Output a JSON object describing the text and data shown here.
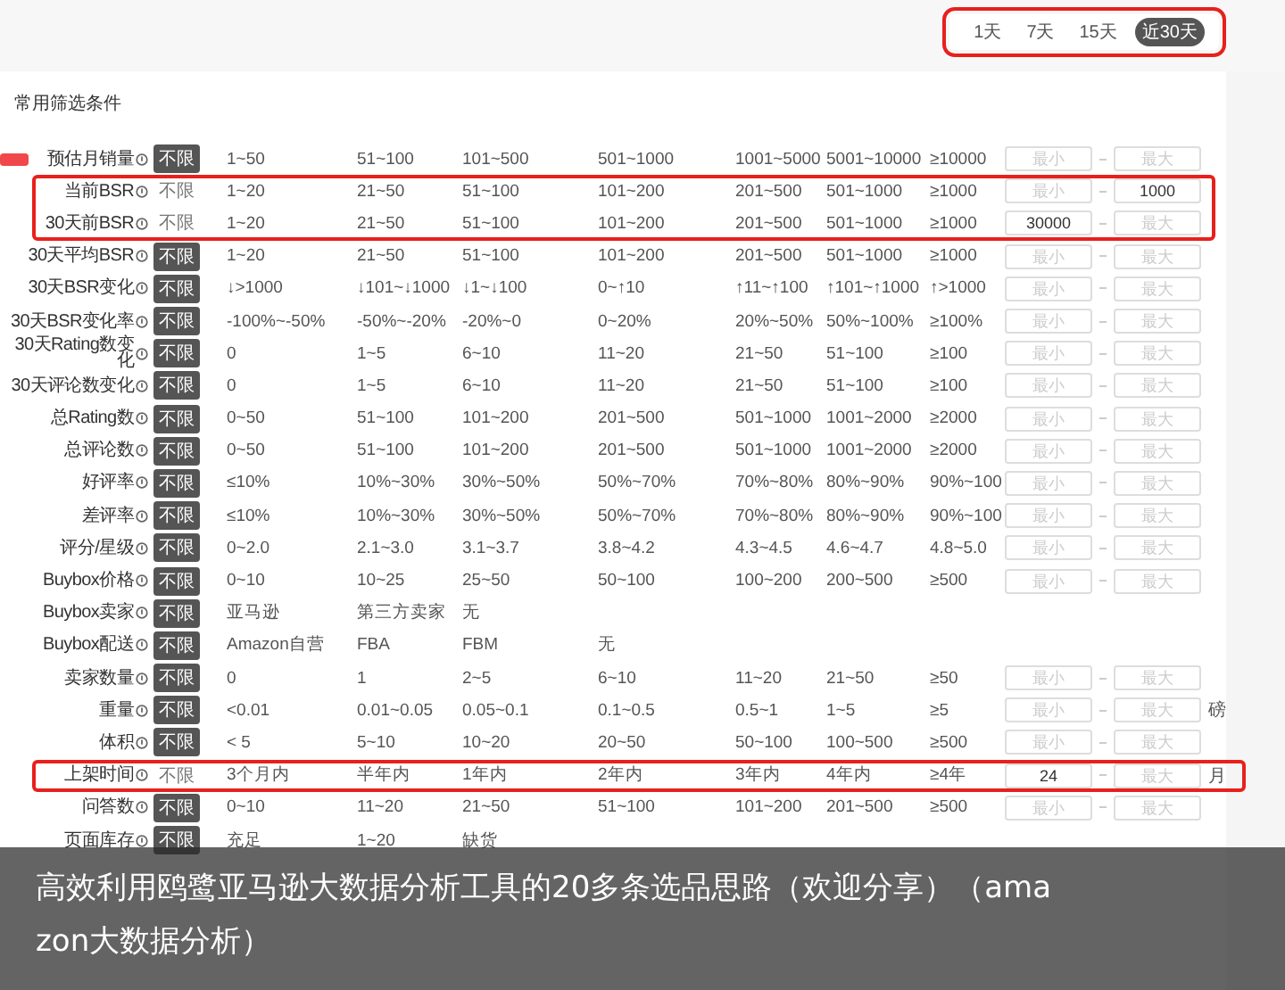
{
  "time_filter": {
    "marked": true,
    "options": [
      {
        "label": "1天",
        "selected": false
      },
      {
        "label": "7天",
        "selected": false
      },
      {
        "label": "15天",
        "selected": false
      },
      {
        "label": "近30天",
        "selected": true
      }
    ]
  },
  "section_title": "常用筛选条件",
  "rows": [
    {
      "label": "预估月销量",
      "new": true,
      "marked": false,
      "any": {
        "label": "不限",
        "selected": true
      },
      "options": [
        "1~50",
        "51~100",
        "101~500",
        "501~1000",
        "1001~5000",
        "5001~10000",
        "≥10000"
      ],
      "min": {
        "placeholder": "最小"
      },
      "max": {
        "placeholder": "最大"
      }
    },
    {
      "label": "当前BSR",
      "new": false,
      "marked": true,
      "any": {
        "label": "不限",
        "selected": false
      },
      "options": [
        "1~20",
        "21~50",
        "51~100",
        "101~200",
        "201~500",
        "501~1000",
        "≥1000"
      ],
      "min": {
        "placeholder": "最小"
      },
      "max": {
        "value": "1000"
      }
    },
    {
      "label": "30天前BSR",
      "new": false,
      "marked": true,
      "any": {
        "label": "不限",
        "selected": false
      },
      "options": [
        "1~20",
        "21~50",
        "51~100",
        "101~200",
        "201~500",
        "501~1000",
        "≥1000"
      ],
      "min": {
        "value": "30000"
      },
      "max": {
        "placeholder": "最大"
      }
    },
    {
      "label": "30天平均BSR",
      "new": false,
      "marked": false,
      "any": {
        "label": "不限",
        "selected": true
      },
      "options": [
        "1~20",
        "21~50",
        "51~100",
        "101~200",
        "201~500",
        "501~1000",
        "≥1000"
      ],
      "min": {
        "placeholder": "最小"
      },
      "max": {
        "placeholder": "最大"
      }
    },
    {
      "label": "30天BSR变化",
      "new": false,
      "marked": false,
      "any": {
        "label": "不限",
        "selected": true
      },
      "options": [
        "↓>1000",
        "↓101~↓1000",
        "↓1~↓100",
        "0~↑10",
        "↑11~↑100",
        "↑101~↑1000",
        "↑>1000"
      ],
      "min": {
        "placeholder": "最小"
      },
      "max": {
        "placeholder": "最大"
      }
    },
    {
      "label": "30天BSR变化率",
      "new": false,
      "marked": false,
      "any": {
        "label": "不限",
        "selected": true
      },
      "options": [
        "-100%~-50%",
        "-50%~-20%",
        "-20%~0",
        "0~20%",
        "20%~50%",
        "50%~100%",
        "≥100%"
      ],
      "min": {
        "placeholder": "最小"
      },
      "max": {
        "placeholder": "最大"
      }
    },
    {
      "label": "30天Rating数变化",
      "new": false,
      "marked": false,
      "any": {
        "label": "不限",
        "selected": true
      },
      "options": [
        "0",
        "1~5",
        "6~10",
        "11~20",
        "21~50",
        "51~100",
        "≥100"
      ],
      "min": {
        "placeholder": "最小"
      },
      "max": {
        "placeholder": "最大"
      }
    },
    {
      "label": "30天评论数变化",
      "new": false,
      "marked": false,
      "any": {
        "label": "不限",
        "selected": true
      },
      "options": [
        "0",
        "1~5",
        "6~10",
        "11~20",
        "21~50",
        "51~100",
        "≥100"
      ],
      "min": {
        "placeholder": "最小"
      },
      "max": {
        "placeholder": "最大"
      }
    },
    {
      "label": "总Rating数",
      "new": false,
      "marked": false,
      "any": {
        "label": "不限",
        "selected": true
      },
      "options": [
        "0~50",
        "51~100",
        "101~200",
        "201~500",
        "501~1000",
        "1001~2000",
        "≥2000"
      ],
      "min": {
        "placeholder": "最小"
      },
      "max": {
        "placeholder": "最大"
      }
    },
    {
      "label": "总评论数",
      "new": false,
      "marked": false,
      "any": {
        "label": "不限",
        "selected": true
      },
      "options": [
        "0~50",
        "51~100",
        "101~200",
        "201~500",
        "501~1000",
        "1001~2000",
        "≥2000"
      ],
      "min": {
        "placeholder": "最小"
      },
      "max": {
        "placeholder": "最大"
      }
    },
    {
      "label": "好评率",
      "new": false,
      "marked": false,
      "any": {
        "label": "不限",
        "selected": true
      },
      "options": [
        "≤10%",
        "10%~30%",
        "30%~50%",
        "50%~70%",
        "70%~80%",
        "80%~90%",
        "90%~100"
      ],
      "min": {
        "placeholder": "最小"
      },
      "max": {
        "placeholder": "最大"
      }
    },
    {
      "label": "差评率",
      "new": false,
      "marked": false,
      "any": {
        "label": "不限",
        "selected": true
      },
      "options": [
        "≤10%",
        "10%~30%",
        "30%~50%",
        "50%~70%",
        "70%~80%",
        "80%~90%",
        "90%~100"
      ],
      "min": {
        "placeholder": "最小"
      },
      "max": {
        "placeholder": "最大"
      }
    },
    {
      "label": "评分/星级",
      "new": false,
      "marked": false,
      "any": {
        "label": "不限",
        "selected": true
      },
      "options": [
        "0~2.0",
        "2.1~3.0",
        "3.1~3.7",
        "3.8~4.2",
        "4.3~4.5",
        "4.6~4.7",
        "4.8~5.0"
      ],
      "min": {
        "placeholder": "最小"
      },
      "max": {
        "placeholder": "最大"
      }
    },
    {
      "label": "Buybox价格",
      "new": false,
      "marked": false,
      "any": {
        "label": "不限",
        "selected": true
      },
      "options": [
        "0~10",
        "10~25",
        "25~50",
        "50~100",
        "100~200",
        "200~500",
        "≥500"
      ],
      "min": {
        "placeholder": "最小"
      },
      "max": {
        "placeholder": "最大"
      }
    },
    {
      "label": "Buybox卖家",
      "new": false,
      "marked": false,
      "any": {
        "label": "不限",
        "selected": true
      },
      "options": [
        "亚马逊",
        "第三方卖家",
        "无"
      ]
    },
    {
      "label": "Buybox配送",
      "new": false,
      "marked": false,
      "any": {
        "label": "不限",
        "selected": true
      },
      "options": [
        "Amazon自营",
        "FBA",
        "FBM",
        "无"
      ]
    },
    {
      "label": "卖家数量",
      "new": false,
      "marked": false,
      "any": {
        "label": "不限",
        "selected": true
      },
      "options": [
        "0",
        "1",
        "2~5",
        "6~10",
        "11~20",
        "21~50",
        "≥50"
      ],
      "min": {
        "placeholder": "最小"
      },
      "max": {
        "placeholder": "最大"
      }
    },
    {
      "label": "重量",
      "new": false,
      "marked": false,
      "any": {
        "label": "不限",
        "selected": true
      },
      "options": [
        "<0.01",
        "0.01~0.05",
        "0.05~0.1",
        "0.1~0.5",
        "0.5~1",
        "1~5",
        "≥5"
      ],
      "min": {
        "placeholder": "最小"
      },
      "max": {
        "placeholder": "最大"
      },
      "unit": "磅"
    },
    {
      "label": "体积",
      "new": false,
      "marked": false,
      "any": {
        "label": "不限",
        "selected": true
      },
      "options": [
        "< 5",
        "5~10",
        "10~20",
        "20~50",
        "50~100",
        "100~500",
        "≥500"
      ],
      "min": {
        "placeholder": "最小"
      },
      "max": {
        "placeholder": "最大"
      }
    },
    {
      "label": "上架时间",
      "new": false,
      "marked": true,
      "any": {
        "label": "不限",
        "selected": false
      },
      "options": [
        "3个月内",
        "半年内",
        "1年内",
        "2年内",
        "3年内",
        "4年内",
        "≥4年"
      ],
      "min": {
        "value": "24"
      },
      "max": {
        "placeholder": "最大"
      },
      "unit": "月"
    },
    {
      "label": "问答数",
      "new": false,
      "marked": false,
      "any": {
        "label": "不限",
        "selected": true
      },
      "options": [
        "0~10",
        "11~20",
        "21~50",
        "51~100",
        "101~200",
        "201~500",
        "≥500"
      ],
      "min": {
        "placeholder": "最小"
      },
      "max": {
        "placeholder": "最大"
      }
    },
    {
      "label": "页面库存",
      "new": false,
      "marked": false,
      "any": {
        "label": "不限",
        "selected": true
      },
      "options": [
        "充足",
        "1~20",
        "缺货"
      ]
    }
  ],
  "caption": "高效利用鸥鹭亚马逊大数据分析工具的20多条选品思路（欢迎分享）（amazon大数据分析）"
}
